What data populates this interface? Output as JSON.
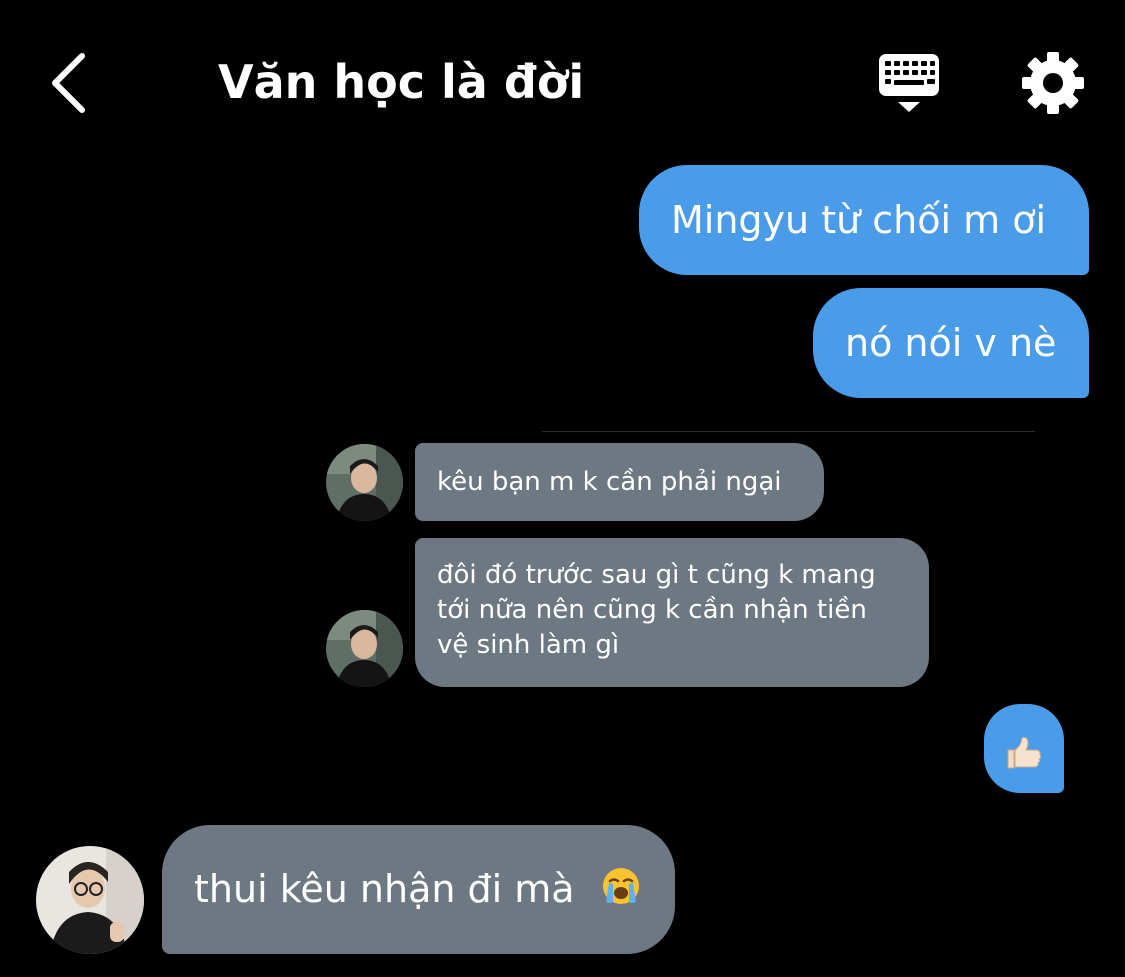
{
  "header": {
    "title": "Văn học là đời"
  },
  "icons": {
    "back": "chevron-left-icon",
    "keyboard": "keyboard-icon",
    "settings": "gear-icon",
    "thumbs_up": "thumbs-up-emoji",
    "crying": "loudly-crying-emoji"
  },
  "messages": [
    {
      "direction": "outgoing",
      "text": "Mingyu từ chối m ơi"
    },
    {
      "direction": "outgoing",
      "text": "nó nói v nè"
    },
    {
      "direction": "incoming",
      "text": "kêu bạn m k cần phải ngại"
    },
    {
      "direction": "incoming",
      "lines": [
        "đôi đó trước sau gì t cũng k mang",
        "tới nữa nên cũng k cần nhận tiền",
        "vệ sinh làm gì"
      ]
    },
    {
      "direction": "outgoing",
      "emoji": "👍🏻"
    },
    {
      "direction": "incoming",
      "text": "thui kêu nhận đi mà",
      "emoji": "😭"
    }
  ],
  "colors": {
    "background": "#000000",
    "outgoing_bubble": "#4a9be8",
    "incoming_bubble": "#6d7883",
    "text": "#ffffff"
  }
}
